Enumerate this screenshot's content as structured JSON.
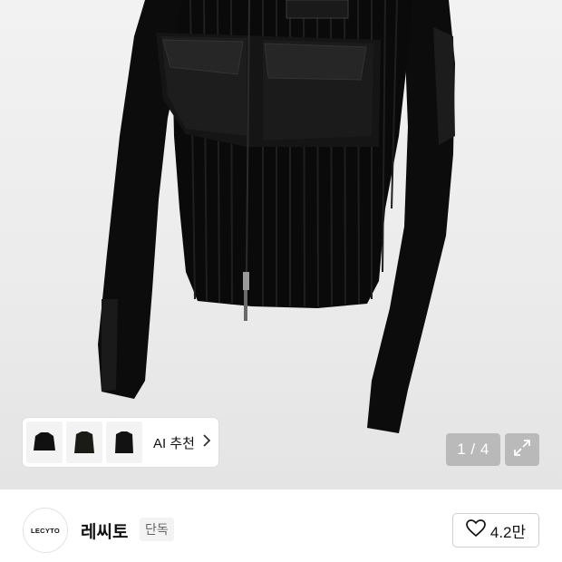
{
  "gallery": {
    "counter_text": "1 / 4",
    "expand_icon": "expand-arrows-icon"
  },
  "recommendation": {
    "label": "AI 추천",
    "thumbnails": [
      "jacket-thumbnail-1",
      "jacket-thumbnail-2",
      "jacket-thumbnail-3"
    ],
    "chevron_icon": "chevron-right-icon"
  },
  "brand": {
    "logo_text": "LECYTO",
    "name": "레씨토",
    "badge": "단독"
  },
  "like": {
    "icon": "heart-outline-icon",
    "count": "4.2만"
  }
}
